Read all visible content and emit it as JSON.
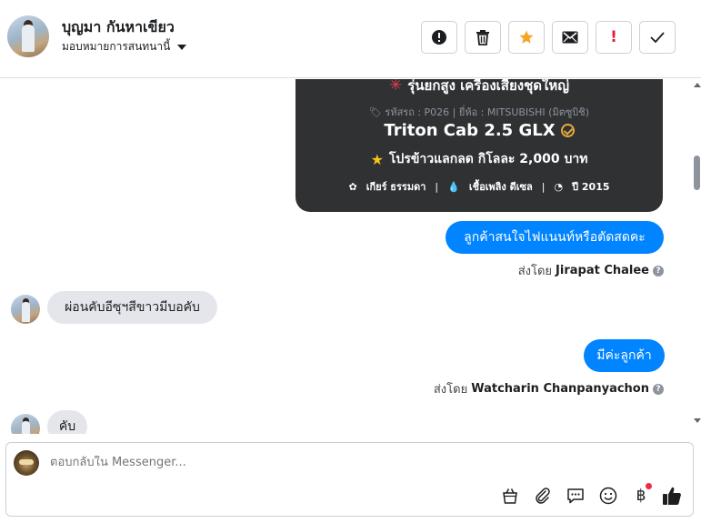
{
  "header": {
    "contact_name": "บุญมา กันหาเขียว",
    "assign_label": "มอบหมายการสนทนานี้"
  },
  "toolbar": {
    "buttons": [
      {
        "name": "mark-spam-button",
        "icon": "alert-circle-icon"
      },
      {
        "name": "delete-button",
        "icon": "trash-icon"
      },
      {
        "name": "star-button",
        "icon": "star-icon",
        "color": "#f5a623"
      },
      {
        "name": "mark-unread-button",
        "icon": "envelope-icon"
      },
      {
        "name": "follow-up-button",
        "icon": "exclamation-icon",
        "color": "#e41e3f",
        "label": "!"
      },
      {
        "name": "mark-done-button",
        "icon": "check-icon"
      }
    ]
  },
  "product_card": {
    "title": "รุ่นยกสูง เครื่องเสียงชุดใหญ่",
    "meta": "รหัสรถ : P026 | ยี่ห้อ : MITSUBISHI (มิตซูบิชิ)",
    "model": "Triton Cab 2.5 GLX",
    "promo": "โปรข้าวแลกลด กิโลละ 2,000 บาท",
    "specs": [
      "เกียร์ ธรรมดา",
      "เชื้อเพลิง ดีเซล",
      "ปี 2015"
    ]
  },
  "messages": [
    {
      "direction": "out",
      "text": "ลูกค้าสนใจไฟแนนท์หรือตัดสดคะ",
      "sent_by_prefix": "ส่งโดย",
      "sent_by": "Jirapat Chalee"
    },
    {
      "direction": "in",
      "text": "ผ่อนคับอีซุฯสีขาวมีบอคับ"
    },
    {
      "direction": "out",
      "text": "มีค่ะลูกค้า",
      "sent_by_prefix": "ส่งโดย",
      "sent_by": "Watcharin Chanpanyachon"
    },
    {
      "direction": "in",
      "text": "คับ"
    }
  ],
  "composer": {
    "placeholder": "ตอบกลับใน Messenger...",
    "tools": [
      "shopping-bag-icon",
      "paperclip-icon",
      "saved-replies-icon",
      "emoji-icon",
      "baht-payment-icon",
      "thumbs-up-icon"
    ]
  },
  "colors": {
    "accent": "#0084ff",
    "card_bg": "#2f3133",
    "incoming_bubble": "#e4e6eb",
    "notification_dot": "#f02849"
  }
}
